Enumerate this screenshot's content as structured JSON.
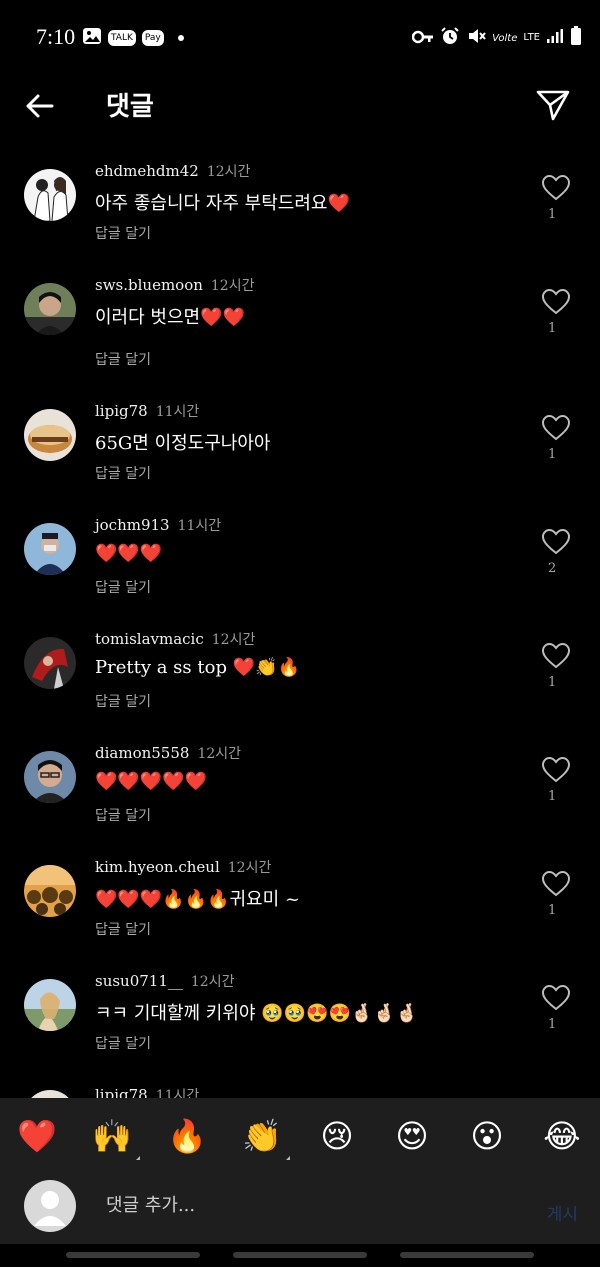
{
  "status_bar": {
    "time": "7:10",
    "left_icons": [
      "gallery-icon",
      "talk-icon",
      "pay-icon"
    ],
    "talk_label": "TALK",
    "pay_label": "Pay",
    "volte": "Volte",
    "lte": "LTE"
  },
  "header": {
    "title": "댓글"
  },
  "comments": [
    {
      "username": "ehdmehdm42",
      "time": "12시간",
      "text": "아주 좋습니다 자주 부탁드려요❤️",
      "reply": "답글 달기",
      "likes": "1"
    },
    {
      "username": "sws.bluemoon",
      "time": "12시간",
      "text": "이러다 벗으면❤️❤️",
      "reply": "답글 달기",
      "likes": "1"
    },
    {
      "username": "lipig78",
      "time": "11시간",
      "text": "65G면 이정도구나아아",
      "reply": "답글 달기",
      "likes": "1"
    },
    {
      "username": "jochm913",
      "time": "11시간",
      "text": "❤️❤️❤️",
      "reply": "답글 달기",
      "likes": "2"
    },
    {
      "username": "tomislavmacic",
      "time": "12시간",
      "text": "Pretty a ss top ❤️👏🔥",
      "reply": "답글 달기",
      "likes": "1"
    },
    {
      "username": "diamon5558",
      "time": "12시간",
      "text": "❤️❤️❤️❤️❤️",
      "reply": "답글 달기",
      "likes": "1"
    },
    {
      "username": "kim.hyeon.cheul",
      "time": "12시간",
      "text": "❤️❤️❤️🔥🔥🔥귀요미 ~",
      "reply": "답글 달기",
      "likes": "1"
    },
    {
      "username": "susu0711__",
      "time": "12시간",
      "text": "ㅋㅋ 기대할께 키위야 🥹🥹😍😍🤞🏻🤞🏻🤞🏻",
      "reply": "답글 달기",
      "likes": "1"
    }
  ],
  "partial_comment": {
    "username": "lipig78",
    "time": "11시간"
  },
  "emoji_bar": [
    {
      "emoji": "❤️",
      "name": "heart-emoji"
    },
    {
      "emoji": "🙌",
      "name": "raised-hands-emoji"
    },
    {
      "emoji": "🔥",
      "name": "fire-emoji"
    },
    {
      "emoji": "👏",
      "name": "clap-emoji"
    },
    {
      "emoji": "😢",
      "name": "crying-emoji"
    },
    {
      "emoji": "😍",
      "name": "heart-eyes-emoji"
    },
    {
      "emoji": "😮",
      "name": "surprised-emoji"
    },
    {
      "emoji": "😂",
      "name": "tears-of-joy-emoji"
    }
  ],
  "input": {
    "placeholder": "댓글 추가...",
    "post_label": "게시"
  },
  "colors": {
    "background": "#000000",
    "panel": "#1e1e1e",
    "secondary_text": "#a8a8a8",
    "post_disabled": "#1f3b66"
  }
}
